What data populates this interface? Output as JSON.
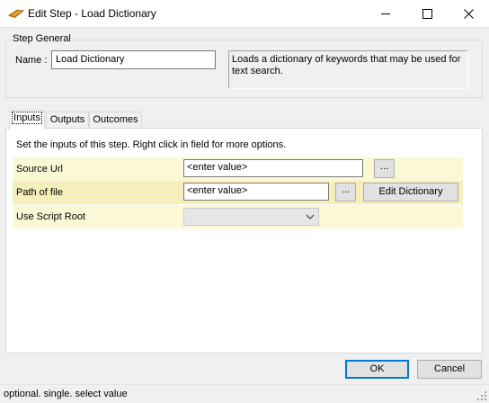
{
  "window": {
    "title": "Edit Step - Load Dictionary"
  },
  "general": {
    "group_label": "Step General",
    "name_label": "Name :",
    "name_value": "Load Dictionary",
    "description": "Loads a dictionary of keywords that may be used for text search."
  },
  "tabs": [
    {
      "label": "Inputs",
      "active": true
    },
    {
      "label": "Outputs",
      "active": false
    },
    {
      "label": "Outcomes",
      "active": false
    }
  ],
  "inputs": {
    "instructions": "Set the inputs of this step.  Right click in field for more options.",
    "rows": [
      {
        "label": "Source Url",
        "value": "<enter value>",
        "browse_label": "..."
      },
      {
        "label": "Path of file",
        "value": "<enter value>",
        "browse_label": "...",
        "extra_button": "Edit Dictionary"
      },
      {
        "label": "Use Script Root",
        "value": ""
      }
    ]
  },
  "footer": {
    "ok_label": "OK",
    "cancel_label": "Cancel"
  },
  "status": {
    "text": "optional. single. select value"
  },
  "colors": {
    "row_light": "#fbf8d6",
    "row_dark": "#f6efbc",
    "ok_border": "#0078d7"
  }
}
